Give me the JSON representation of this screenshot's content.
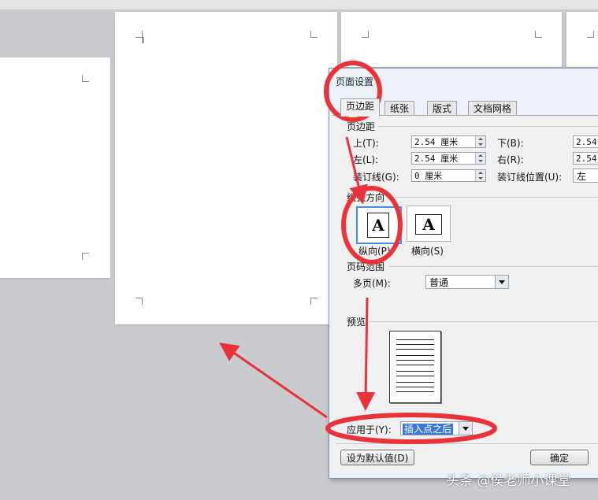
{
  "dialog": {
    "title": "页面设置",
    "tabs": [
      "页边距",
      "纸张",
      "版式",
      "文档网格"
    ],
    "margins": {
      "group_label": "页边距",
      "top_label": "上(T):",
      "top_value": "2.54 厘米",
      "bottom_label": "下(B):",
      "bottom_value": "2.54",
      "left_label": "左(L):",
      "left_value": "2.54 厘米",
      "right_label": "右(R):",
      "right_value": "2.54",
      "gutter_label": "装订线(G):",
      "gutter_value": "0 厘米",
      "gutter_pos_label": "装订线位置(U):",
      "gutter_pos_value": "左"
    },
    "orientation": {
      "group_label": "纸张方向",
      "portrait_label": "纵向(P)",
      "landscape_label": "横向(S)",
      "icon_letter": "A"
    },
    "pages": {
      "group_label": "页码范围",
      "multi_label": "多页(M):",
      "multi_value": "普通"
    },
    "preview": {
      "group_label": "预览"
    },
    "apply": {
      "label": "应用于(Y):",
      "value": "插入点之后"
    },
    "buttons": {
      "default_label": "设为默认值(D)",
      "ok_label": "确定"
    }
  },
  "watermark": "头条 @侯老师小课堂",
  "colors": {
    "annotation": "#e8333a",
    "selection": "#3a78d8"
  }
}
